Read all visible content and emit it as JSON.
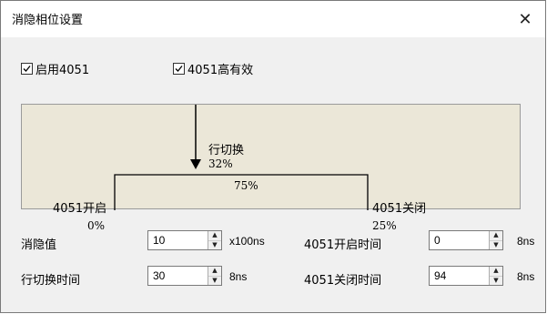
{
  "window": {
    "title": "消隐相位设置",
    "close_icon": "close-icon"
  },
  "options": {
    "enable_4051": {
      "label": "启用4051",
      "checked": true
    },
    "high_active_4051": {
      "label": "4051高有效",
      "checked": true
    }
  },
  "diagram": {
    "row_switch_label": "行切换",
    "row_switch_pct": "32%",
    "high_pct": "75%",
    "open_label": "4051开启",
    "open_pct": "0%",
    "close_label": "4051关闭",
    "close_pct": "25%"
  },
  "fields": {
    "blanking_value": {
      "label": "消隐值",
      "value": "10",
      "unit": "x100ns"
    },
    "open_time": {
      "label": "4051开启时间",
      "value": "0",
      "unit": "8ns"
    },
    "row_switch_time": {
      "label": "行切换时间",
      "value": "30",
      "unit": "8ns"
    },
    "close_time": {
      "label": "4051关闭时间",
      "value": "94",
      "unit": "8ns"
    }
  }
}
